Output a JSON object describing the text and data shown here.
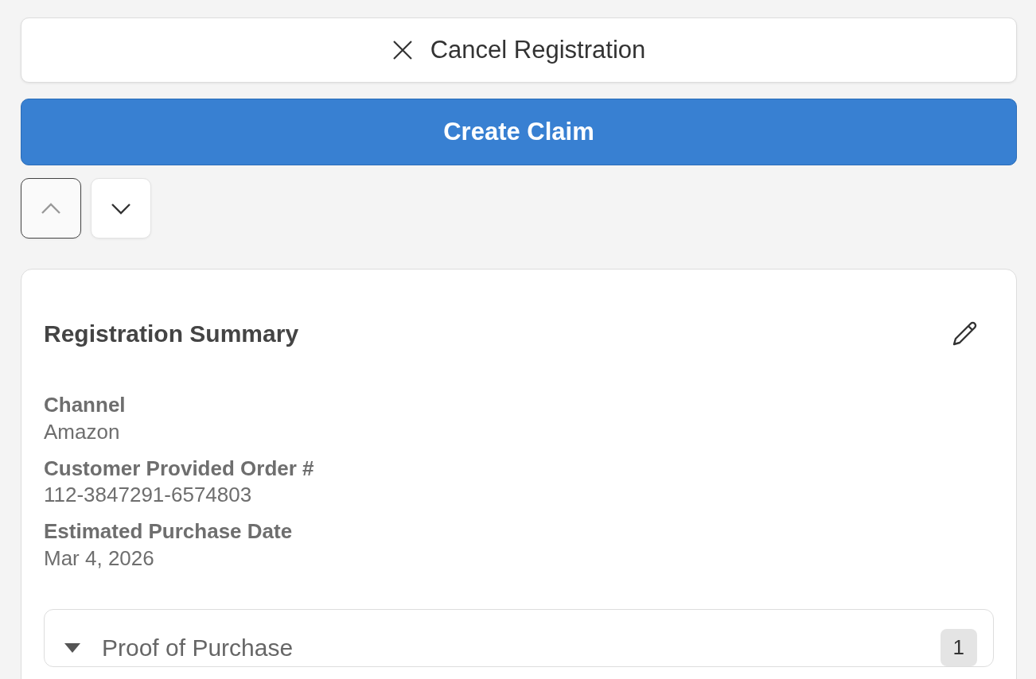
{
  "cancel_button": {
    "label": "Cancel Registration"
  },
  "create_button": {
    "label": "Create Claim"
  },
  "nav_buttons": [
    {
      "kind": "up",
      "disabled": true
    },
    {
      "kind": "down",
      "disabled": false
    }
  ],
  "summary": {
    "title": "Registration Summary",
    "fields": [
      {
        "label": "Channel",
        "value": "Amazon"
      },
      {
        "label": "Customer Provided Order #",
        "value": "112-3847291-6574803"
      },
      {
        "label": "Estimated Purchase Date",
        "value": "Mar 4, 2026"
      }
    ],
    "section": {
      "title": "Proof of Purchase",
      "count": "1",
      "expanded": true
    }
  }
}
